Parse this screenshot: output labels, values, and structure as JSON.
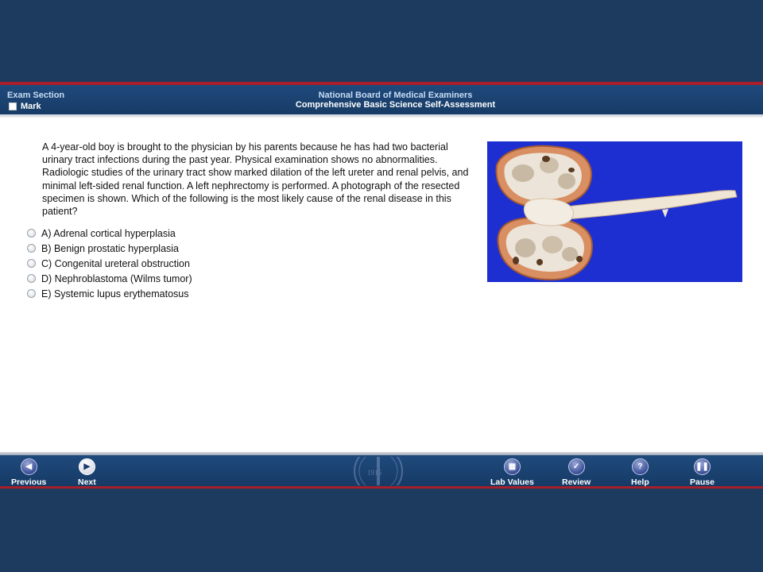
{
  "header": {
    "exam_section_label": "Exam Section",
    "mark_label": "Mark",
    "org_title": "National Board of Medical Examiners",
    "exam_title": "Comprehensive Basic Science Self-Assessment"
  },
  "question": {
    "stem": "A 4-year-old boy is brought to the physician by his parents because he has had two bacterial urinary tract infections during the past year. Physical examination shows no abnormalities. Radiologic studies of the urinary tract show marked dilation of the left ureter and renal pelvis, and minimal left-sided renal function. A left nephrectomy is performed. A photograph of the resected specimen is shown. Which of the following is the most likely cause of the renal disease in this patient?",
    "options": [
      {
        "label": "A) Adrenal cortical hyperplasia"
      },
      {
        "label": "B) Benign prostatic hyperplasia"
      },
      {
        "label": "C) Congenital ureteral obstruction"
      },
      {
        "label": "D) Nephroblastoma (Wilms tumor)"
      },
      {
        "label": "E) Systemic lupus erythematosus"
      }
    ]
  },
  "footer": {
    "previous": "Previous",
    "next": "Next",
    "lab_values": "Lab Values",
    "review": "Review",
    "help": "Help",
    "pause": "Pause",
    "seal_text": "1915"
  },
  "colors": {
    "background": "#1d3a5f",
    "header": "#1f4a7c",
    "accent_red": "#a81e2a",
    "photo_background": "#1d2fd0"
  }
}
